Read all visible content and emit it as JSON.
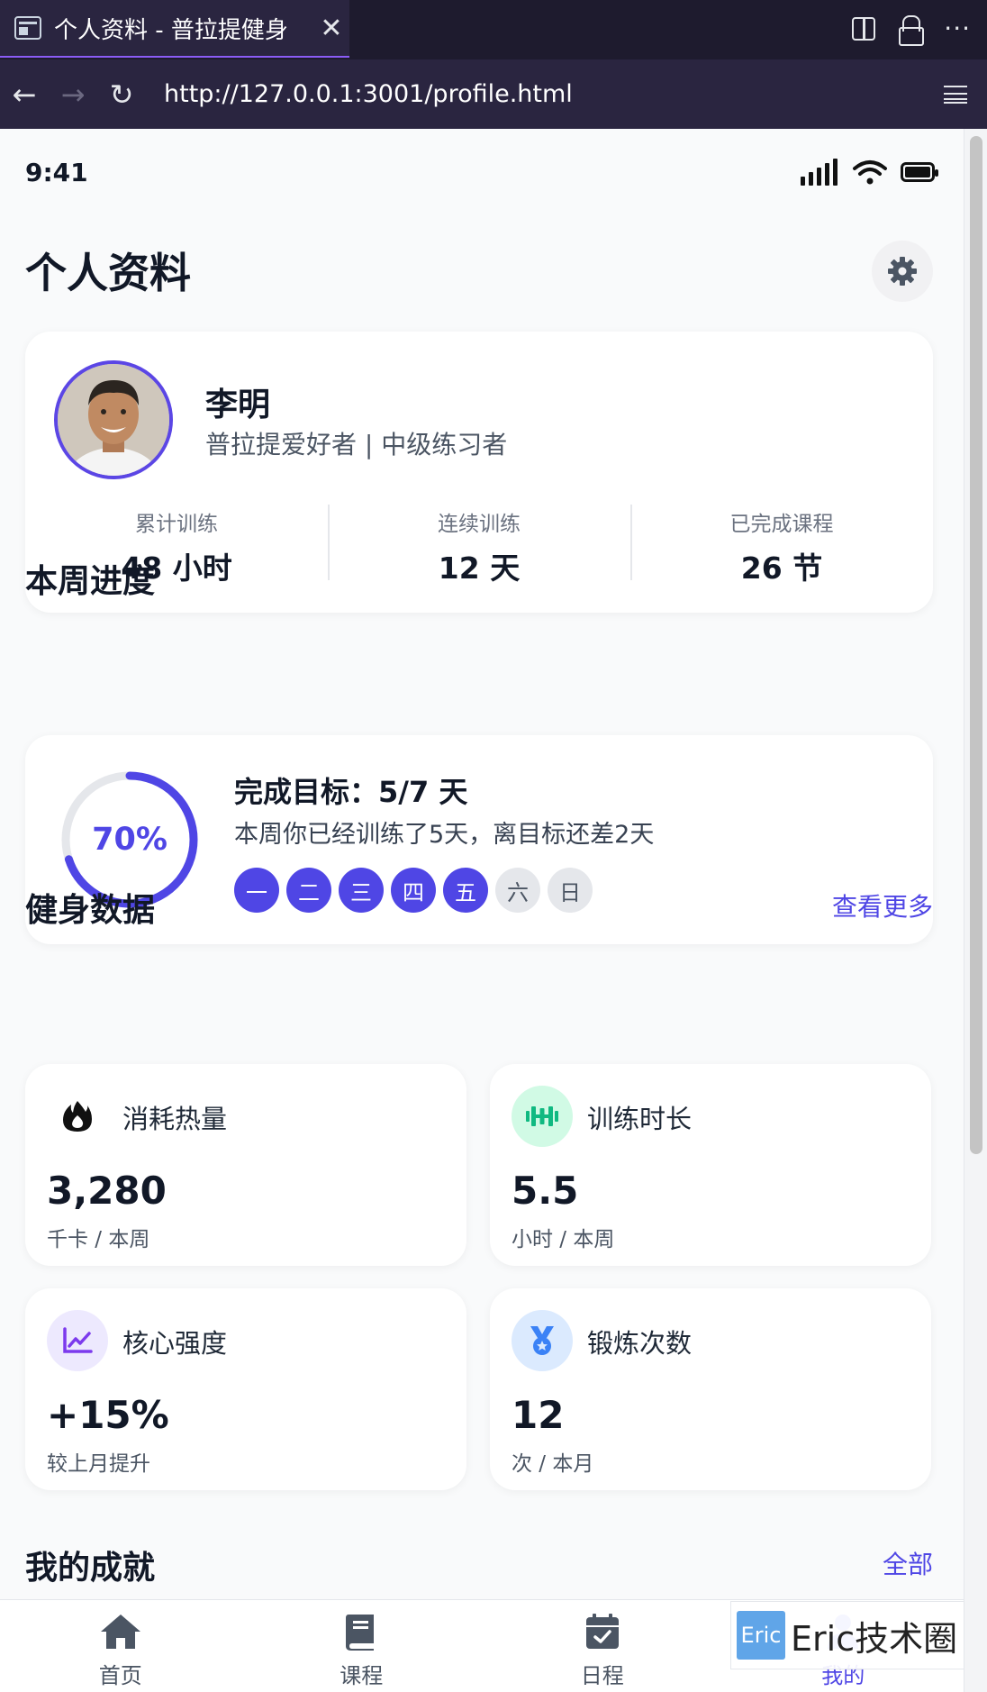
{
  "browser": {
    "tab_title": "个人资料 - 普拉提健身",
    "tab_close": "✕",
    "url": "http://127.0.0.1:3001/profile.html",
    "back": "←",
    "forward": "→",
    "reload": "↻",
    "more": "···"
  },
  "status": {
    "time": "9:41"
  },
  "header": {
    "title": "个人资料"
  },
  "profile": {
    "name": "李明",
    "subtitle": "普拉提爱好者 | 中级练习者",
    "stats": [
      {
        "label": "累计训练",
        "value": "48 小时"
      },
      {
        "label": "连续训练",
        "value": "12 天"
      },
      {
        "label": "已完成课程",
        "value": "26 节"
      }
    ]
  },
  "weekly": {
    "section_title": "本周进度",
    "percent_text": "70%",
    "percent_value": 0.7,
    "goal_title": "完成目标：5/7 天",
    "goal_desc": "本周你已经训练了5天，离目标还差2天",
    "days": [
      {
        "label": "一",
        "done": true
      },
      {
        "label": "二",
        "done": true
      },
      {
        "label": "三",
        "done": true
      },
      {
        "label": "四",
        "done": true
      },
      {
        "label": "五",
        "done": true
      },
      {
        "label": "六",
        "done": false
      },
      {
        "label": "日",
        "done": false
      }
    ]
  },
  "fitness": {
    "section_title": "健身数据",
    "more_link": "查看更多",
    "metrics": [
      {
        "label": "消耗热量",
        "value": "3,280",
        "unit": "千卡 / 本周",
        "icon": "fire-icon"
      },
      {
        "label": "训练时长",
        "value": "5.5",
        "unit": "小时 / 本周",
        "icon": "dumbbell-icon",
        "icon_bg": "#d1fae5",
        "icon_color": "#10b981"
      },
      {
        "label": "核心强度",
        "value": "+15%",
        "unit": "较上月提升",
        "icon": "chart-line-icon",
        "icon_bg": "#ede9fe",
        "icon_color": "#7c3aed"
      },
      {
        "label": "锻炼次数",
        "value": "12",
        "unit": "次 / 本月",
        "icon": "medal-icon",
        "icon_bg": "#dbeafe",
        "icon_color": "#3b82f6"
      }
    ]
  },
  "achievements": {
    "section_title": "我的成就",
    "all_link": "全部"
  },
  "bottom_nav": [
    {
      "label": "首页",
      "icon": "home-icon"
    },
    {
      "label": "课程",
      "icon": "book-icon"
    },
    {
      "label": "日程",
      "icon": "calendar-check-icon"
    },
    {
      "label": "我的",
      "icon": "user-icon",
      "active": true
    }
  ],
  "watermark": {
    "badge": "Eric",
    "text": "Eric技术圈"
  },
  "colors": {
    "accent": "#4f46e5",
    "browser_bg": "#1e1b2e"
  }
}
